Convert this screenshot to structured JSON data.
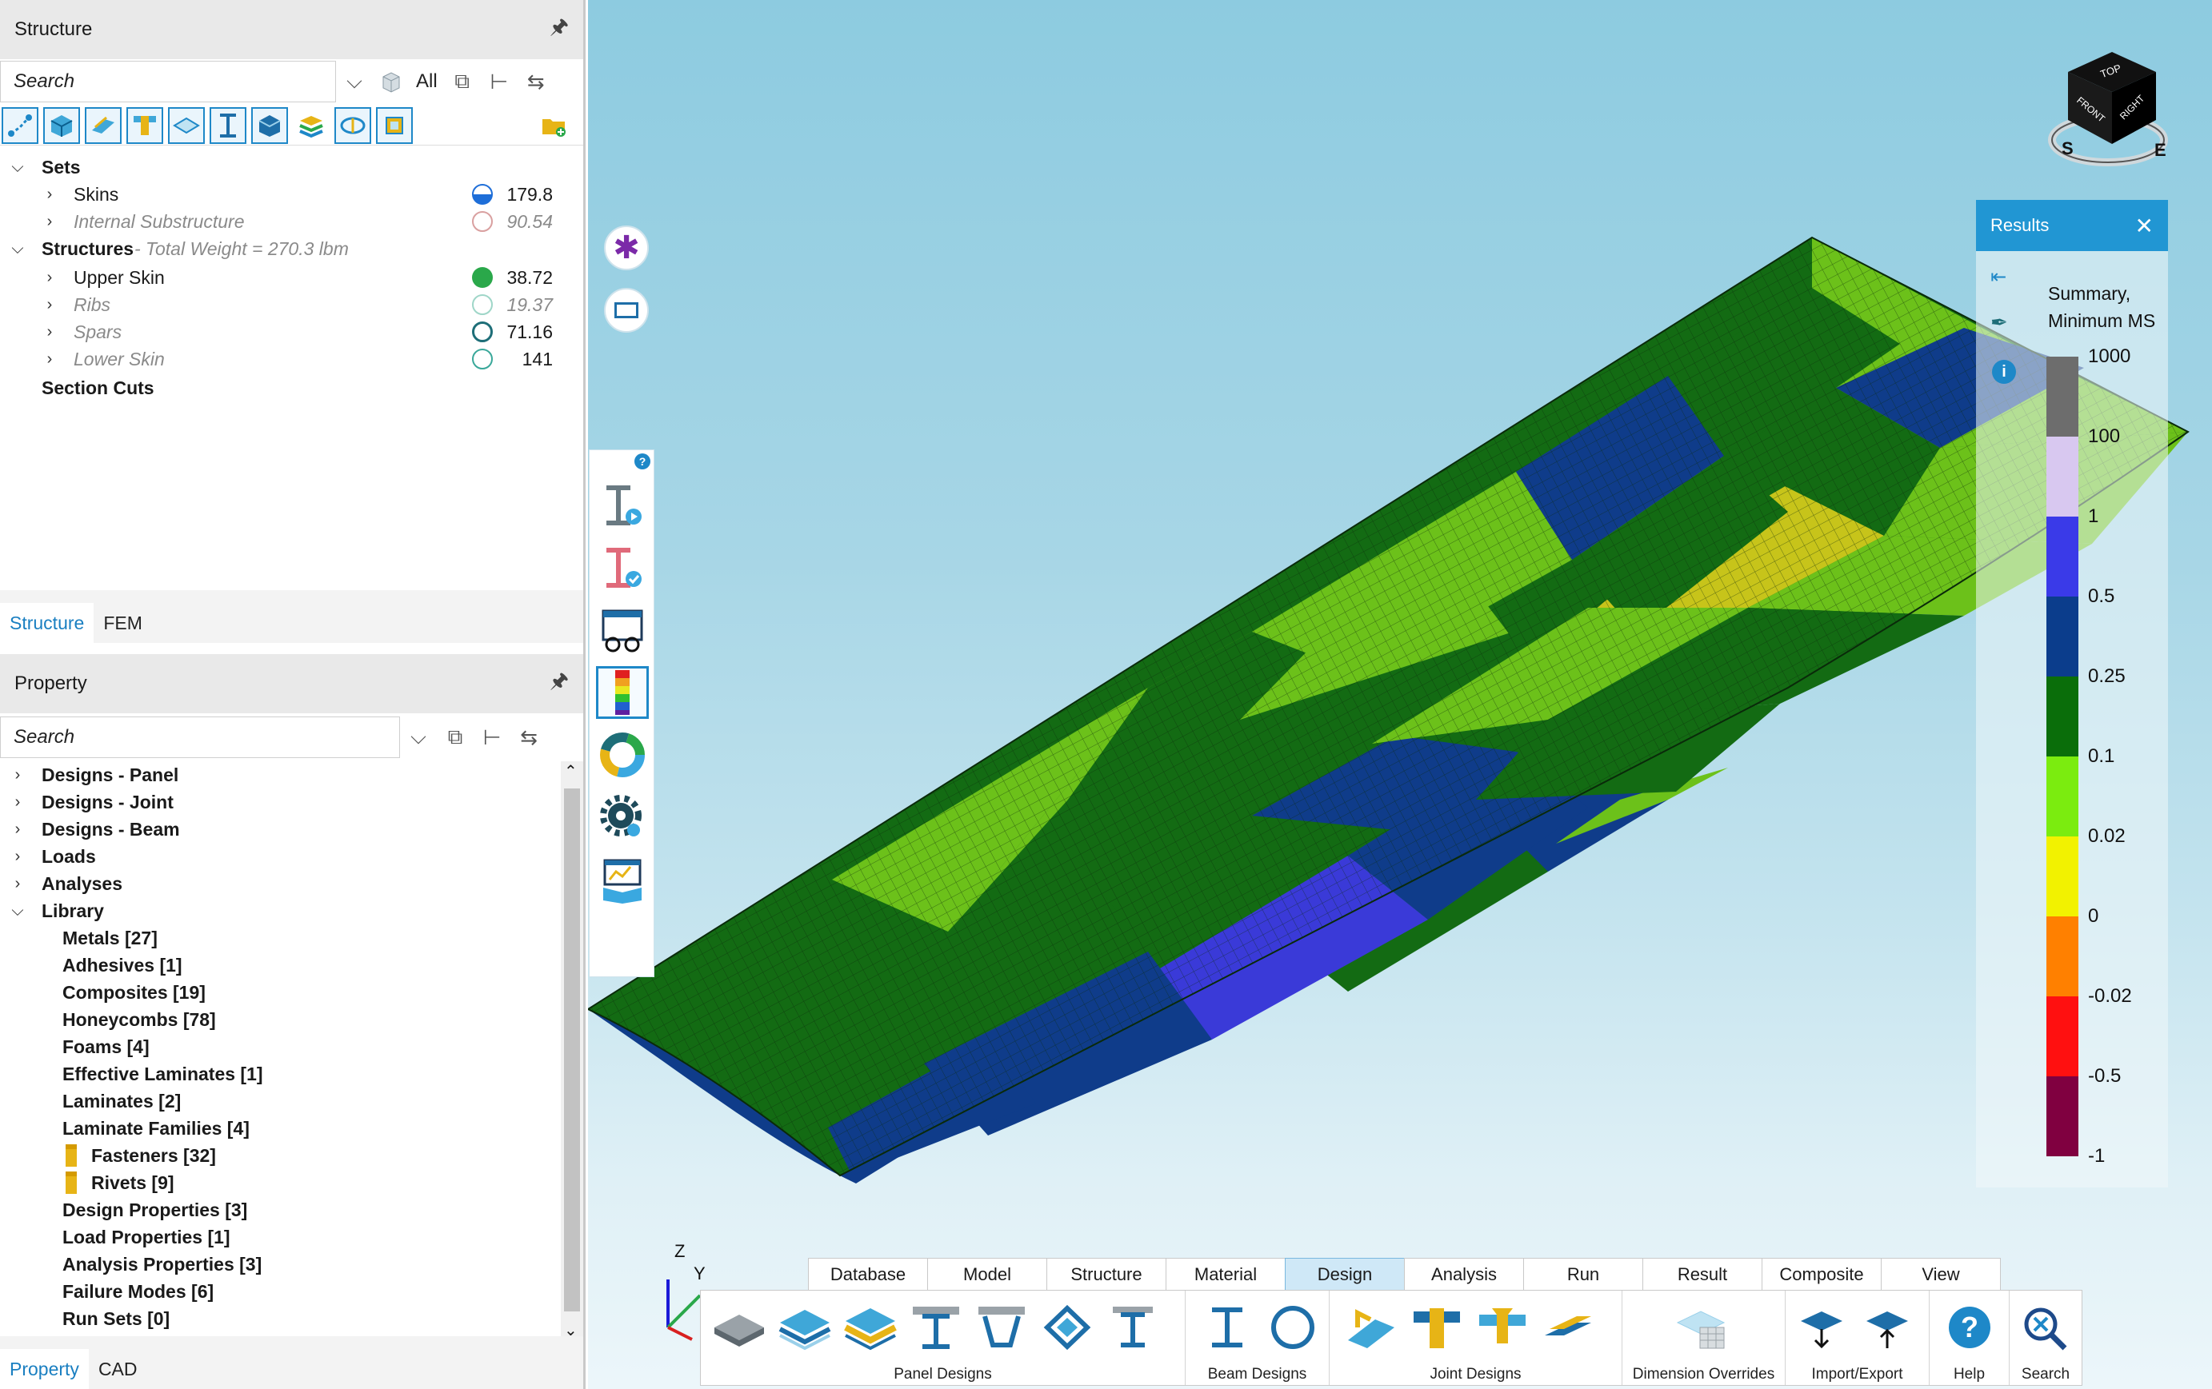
{
  "structure_panel": {
    "title": "Structure",
    "search_placeholder": "Search",
    "filter_label": "All",
    "tree": {
      "sets_label": "Sets",
      "skins_label": "Skins",
      "skins_value": "179.8",
      "internal_label": "Internal Substructure",
      "internal_value": "90.54",
      "structures_label": "Structures",
      "structures_note": "- Total Weight = 270.3 lbm",
      "upper_label": "Upper Skin",
      "upper_value": "38.72",
      "ribs_label": "Ribs",
      "ribs_value": "19.37",
      "spars_label": "Spars",
      "spars_value": "71.16",
      "lower_label": "Lower Skin",
      "lower_value": "141",
      "section_cuts_label": "Section Cuts"
    },
    "tabs": [
      "Structure",
      "FEM"
    ]
  },
  "property_panel": {
    "title": "Property",
    "search_placeholder": "Search",
    "items": [
      "Designs - Panel",
      "Designs - Joint",
      "Designs - Beam",
      "Loads",
      "Analyses",
      "Library"
    ],
    "library_items": [
      "Metals [27]",
      "Adhesives [1]",
      "Composites [19]",
      "Honeycombs [78]",
      "Foams [4]",
      "Effective Laminates [1]",
      "Laminates [2]",
      "Laminate Families [4]",
      "Fasteners [32]",
      "Rivets [9]",
      "Design Properties [3]",
      "Load Properties [1]",
      "Analysis Properties [3]",
      "Failure Modes [6]",
      "Run Sets [0]"
    ],
    "tabs": [
      "Property",
      "CAD"
    ]
  },
  "results_panel": {
    "title": "Results",
    "subtitle_line1": "Summary,",
    "subtitle_line2": "Minimum MS",
    "legend_labels": [
      "1000",
      "100",
      "1",
      "0.5",
      "0.25",
      "0.1",
      "0.02",
      "0",
      "-0.02",
      "-0.5",
      "-1"
    ],
    "legend_colors": [
      "#6d6d6d",
      "#d8c8f0",
      "#3a3ae8",
      "#0b3d8c",
      "#0a6e0a",
      "#7bec0f",
      "#f2f200",
      "#ff8000",
      "#ff1010",
      "#800040"
    ]
  },
  "nav_cube": {
    "top": "TOP",
    "front": "FRONT",
    "right": "RIGHT",
    "compass_s": "S",
    "compass_e": "E"
  },
  "triad": {
    "z": "Z",
    "y": "Y"
  },
  "ribbon": {
    "tabs": [
      "Database",
      "Model",
      "Structure",
      "Material",
      "Design",
      "Analysis",
      "Run",
      "Result",
      "Composite",
      "View"
    ],
    "active_tab": "Design",
    "groups": [
      "Panel Designs",
      "Beam Designs",
      "Joint Designs",
      "Dimension Overrides",
      "Import/Export",
      "Help",
      "Search"
    ]
  },
  "colors": {
    "accent": "#1e88c8",
    "results_header": "#2196d3",
    "mesh_dark_green": "#136b13",
    "mesh_light_green": "#6cc11a",
    "mesh_yellow": "#c7c41a",
    "mesh_blue": "#0f3c8a",
    "mesh_violet": "#3a3ad8"
  }
}
